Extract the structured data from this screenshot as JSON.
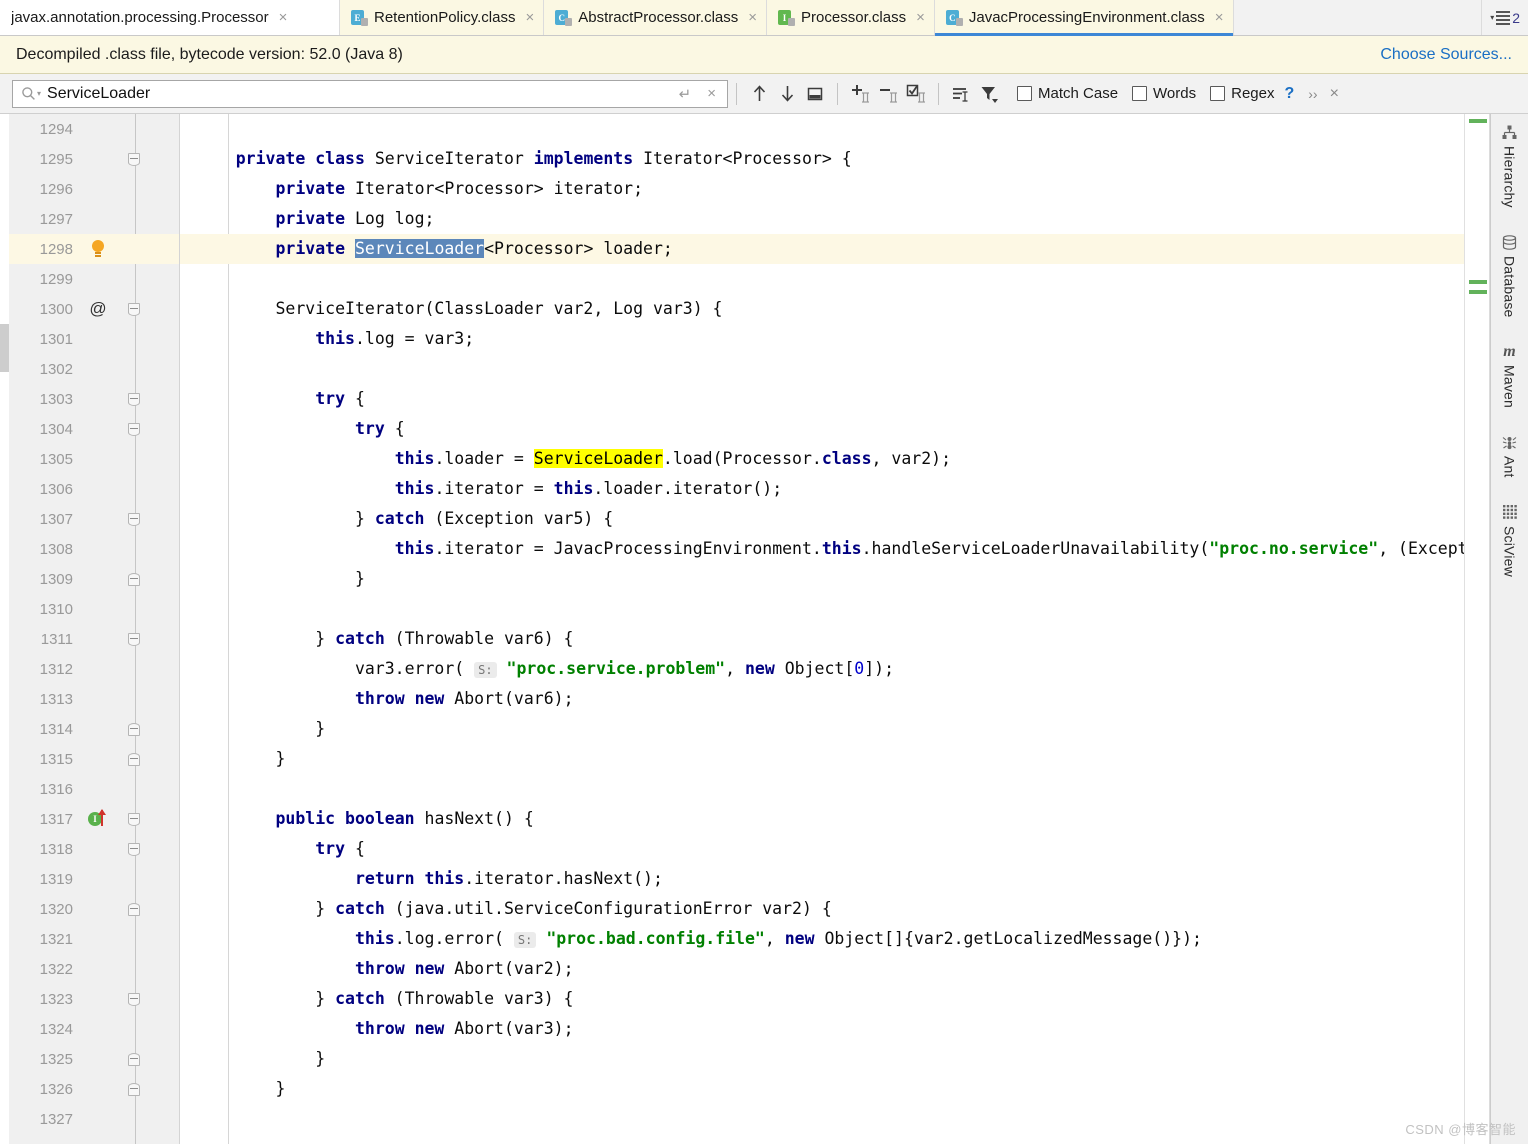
{
  "tabs": [
    {
      "label": "javax.annotation.processing.Processor",
      "icon": "",
      "active": false,
      "kind": "plain",
      "close": "×"
    },
    {
      "label": "RetentionPolicy.class",
      "icon": "E",
      "active": false,
      "kind": "enum",
      "close": "×"
    },
    {
      "label": "AbstractProcessor.class",
      "icon": "C",
      "active": false,
      "kind": "class",
      "close": "×"
    },
    {
      "label": "Processor.class",
      "icon": "I",
      "active": false,
      "kind": "interface",
      "close": "×"
    },
    {
      "label": "JavacProcessingEnvironment.class",
      "icon": "C",
      "active": true,
      "kind": "class",
      "close": "×"
    }
  ],
  "tab_overflow": {
    "count": "2",
    "caret": "▾"
  },
  "banner": {
    "message": "Decompiled .class file, bytecode version: 52.0 (Java 8)",
    "action_label": "Choose Sources..."
  },
  "find": {
    "query": "ServiceLoader",
    "placeholder": "Search",
    "magnifier_caret": "▾",
    "history_icon": "↵",
    "clear_icon": "×",
    "buttons": [
      {
        "name": "find-previous",
        "glyph": "↑"
      },
      {
        "name": "find-next",
        "glyph": "↓"
      },
      {
        "name": "select-in-editor",
        "glyph": "▭"
      },
      {
        "name": "add-selection-next-occurrence",
        "glyph": "+"
      },
      {
        "name": "remove-selection",
        "glyph": "−"
      },
      {
        "name": "select-all-occurrences",
        "glyph": "☑"
      },
      {
        "name": "filter-search-results",
        "glyph": "≡"
      },
      {
        "name": "filter-funnel",
        "glyph": "▼"
      }
    ],
    "checkboxes": [
      {
        "label": "Match Case",
        "checked": false
      },
      {
        "label": "Words",
        "checked": false
      },
      {
        "label": "Regex",
        "checked": false
      }
    ],
    "help_glyph": "?",
    "more_glyph": "››",
    "close_glyph": "×"
  },
  "editor": {
    "first_line": 1294,
    "highlighted_line": 1298,
    "lines": [
      {
        "n": 1294,
        "text": ""
      },
      {
        "n": 1295,
        "text": "    private class ServiceIterator implements Iterator<Processor> {"
      },
      {
        "n": 1296,
        "text": "        private Iterator<Processor> iterator;"
      },
      {
        "n": 1297,
        "text": "        private Log log;"
      },
      {
        "n": 1298,
        "text": "        private ServiceLoader<Processor> loader;"
      },
      {
        "n": 1299,
        "text": ""
      },
      {
        "n": 1300,
        "text": "        ServiceIterator(ClassLoader var2, Log var3) {"
      },
      {
        "n": 1301,
        "text": "            this.log = var3;"
      },
      {
        "n": 1302,
        "text": ""
      },
      {
        "n": 1303,
        "text": "            try {"
      },
      {
        "n": 1304,
        "text": "                try {"
      },
      {
        "n": 1305,
        "text": "                    this.loader = ServiceLoader.load(Processor.class, var2);"
      },
      {
        "n": 1306,
        "text": "                    this.iterator = this.loader.iterator();"
      },
      {
        "n": 1307,
        "text": "                } catch (Exception var5) {"
      },
      {
        "n": 1308,
        "text": "                    this.iterator = JavacProcessingEnvironment.this.handleServiceLoaderUnavailability(\"proc.no.service\", (Exception)null"
      },
      {
        "n": 1309,
        "text": "                }"
      },
      {
        "n": 1310,
        "text": ""
      },
      {
        "n": 1311,
        "text": "            } catch (Throwable var6) {"
      },
      {
        "n": 1312,
        "text": "                var3.error( S: \"proc.service.problem\", new Object[0]);"
      },
      {
        "n": 1313,
        "text": "                throw new Abort(var6);"
      },
      {
        "n": 1314,
        "text": "            }"
      },
      {
        "n": 1315,
        "text": "        }"
      },
      {
        "n": 1316,
        "text": ""
      },
      {
        "n": 1317,
        "text": "        public boolean hasNext() {"
      },
      {
        "n": 1318,
        "text": "            try {"
      },
      {
        "n": 1319,
        "text": "                return this.iterator.hasNext();"
      },
      {
        "n": 1320,
        "text": "            } catch (java.util.ServiceConfigurationError var2) {"
      },
      {
        "n": 1321,
        "text": "                this.log.error( S: \"proc.bad.config.file\", new Object[]{var2.getLocalizedMessage()});"
      },
      {
        "n": 1322,
        "text": "                throw new Abort(var2);"
      },
      {
        "n": 1323,
        "text": "            } catch (Throwable var3) {"
      },
      {
        "n": 1324,
        "text": "                throw new Abort(var3);"
      },
      {
        "n": 1325,
        "text": "            }"
      },
      {
        "n": 1326,
        "text": "        }"
      },
      {
        "n": 1327,
        "text": ""
      }
    ],
    "gutter_markers": {
      "1298": "intention-bulb",
      "1300": "annotation-at",
      "1317": "implementing-method"
    },
    "annotation_glyph": "@",
    "impl_glyph": "I",
    "fold_start_lines": [
      1295,
      1300,
      1303,
      1304,
      1307,
      1311,
      1317,
      1318,
      1323
    ],
    "fold_end_lines": [
      1309,
      1314,
      1315,
      1320,
      1325,
      1326
    ],
    "parameter_hint": "S:",
    "search_highlight_term": "ServiceLoader",
    "selected_term": "ServiceLoader"
  },
  "toolwindows": [
    {
      "label": "Hierarchy",
      "icon": "hierarchy-icon"
    },
    {
      "label": "Database",
      "icon": "database-icon"
    },
    {
      "label": "Maven",
      "icon": "maven-icon"
    },
    {
      "label": "Ant",
      "icon": "ant-icon"
    },
    {
      "label": "SciView",
      "icon": "sciview-icon"
    }
  ],
  "watermark": "CSDN @博客智能",
  "colors": {
    "accent": "#3d87d6",
    "banner_bg": "#fbf8e3",
    "keyword": "#000080",
    "string": "#008000",
    "search_hit": "#ffff00",
    "selection": "#5c87ba",
    "marker_green": "#62b25b"
  }
}
